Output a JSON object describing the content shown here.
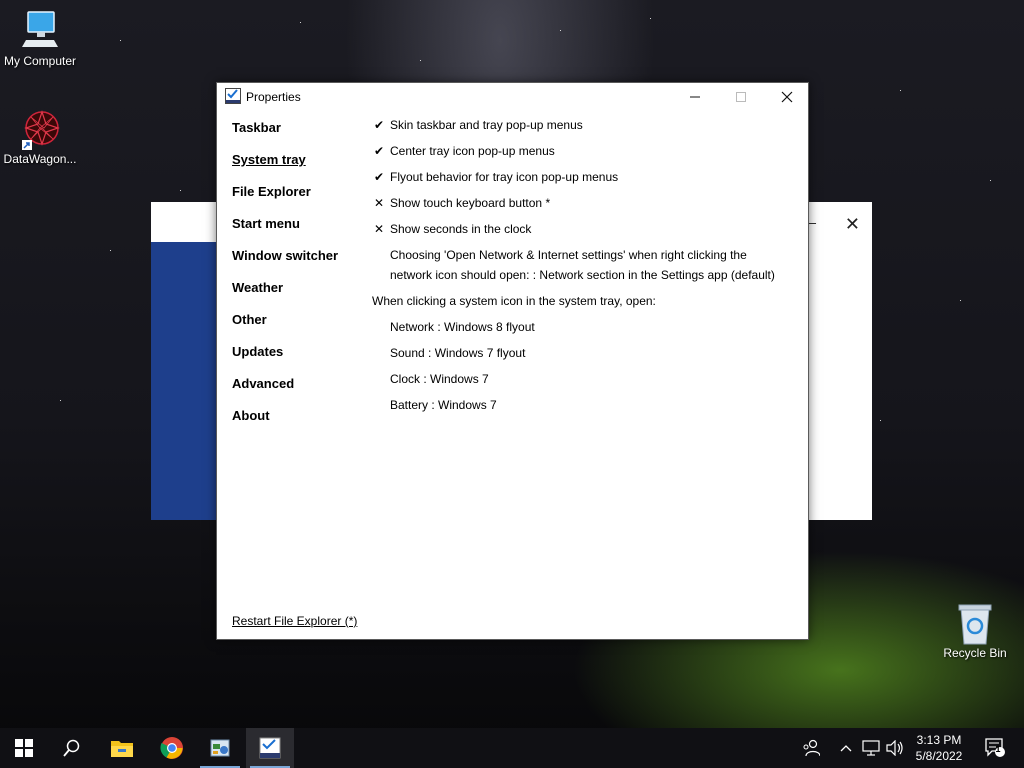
{
  "desktop": {
    "icons": [
      {
        "label": "My Computer"
      },
      {
        "label": "DataWagon..."
      },
      {
        "label": "Recycle Bin"
      }
    ]
  },
  "window": {
    "title": "Properties",
    "nav": [
      {
        "label": "Taskbar"
      },
      {
        "label": "System tray"
      },
      {
        "label": "File Explorer"
      },
      {
        "label": "Start menu"
      },
      {
        "label": "Window switcher"
      },
      {
        "label": "Weather"
      },
      {
        "label": "Other"
      },
      {
        "label": "Updates"
      },
      {
        "label": "Advanced"
      },
      {
        "label": "About"
      }
    ],
    "active_nav": "System tray",
    "options": [
      {
        "mark": "✔",
        "label": "Skin taskbar and tray pop-up menus"
      },
      {
        "mark": "✔",
        "label": "Center tray icon pop-up menus"
      },
      {
        "mark": "✔",
        "label": "Flyout behavior for tray icon pop-up menus"
      },
      {
        "mark": "✕",
        "label": "Show touch keyboard button *"
      },
      {
        "mark": "✕",
        "label": "Show seconds in the clock"
      }
    ],
    "network_setting": {
      "line1": "Choosing 'Open Network & Internet settings' when right clicking the",
      "line2": "network icon should open: : Network section in the Settings app (default)"
    },
    "system_icon_heading": "When clicking a system icon in the system tray, open:",
    "system_icons": [
      {
        "label": "Network : Windows 8 flyout"
      },
      {
        "label": "Sound : Windows 7 flyout"
      },
      {
        "label": "Clock : Windows 7"
      },
      {
        "label": "Battery : Windows 7"
      }
    ],
    "restart_link": "Restart File Explorer (*)"
  },
  "taskbar": {
    "clock_time": "3:13 PM",
    "clock_date": "5/8/2022",
    "notification_count": "1"
  },
  "colors": {
    "accent": "#1e3f8c",
    "taskbar": "#101014",
    "tent": "#78c828"
  }
}
